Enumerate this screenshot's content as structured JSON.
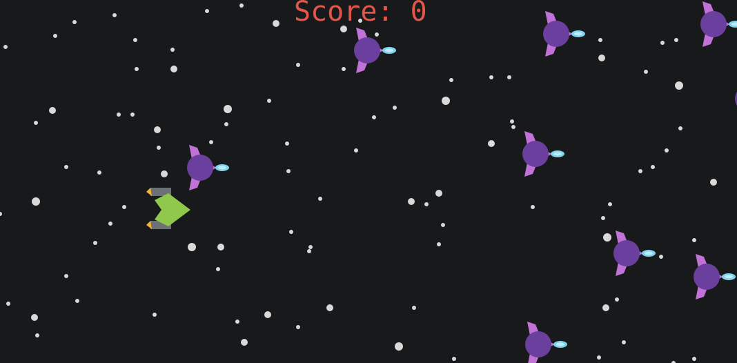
{
  "hud": {
    "score_label": "Score:",
    "score_value": "0"
  },
  "colors": {
    "background": "#17191b",
    "score_text": "#e4564a",
    "star": "#d9d9d9",
    "enemy_body": "#6b3f9e",
    "enemy_wing": "#c072d6",
    "enemy_thruster": "#7fd3ee",
    "player_body": "#8fc84a",
    "player_engine": "#6c7176",
    "player_flame": "#f2b233"
  },
  "sprites": {
    "player": "player-ship",
    "enemy": "enemy-ship",
    "star": "star"
  }
}
